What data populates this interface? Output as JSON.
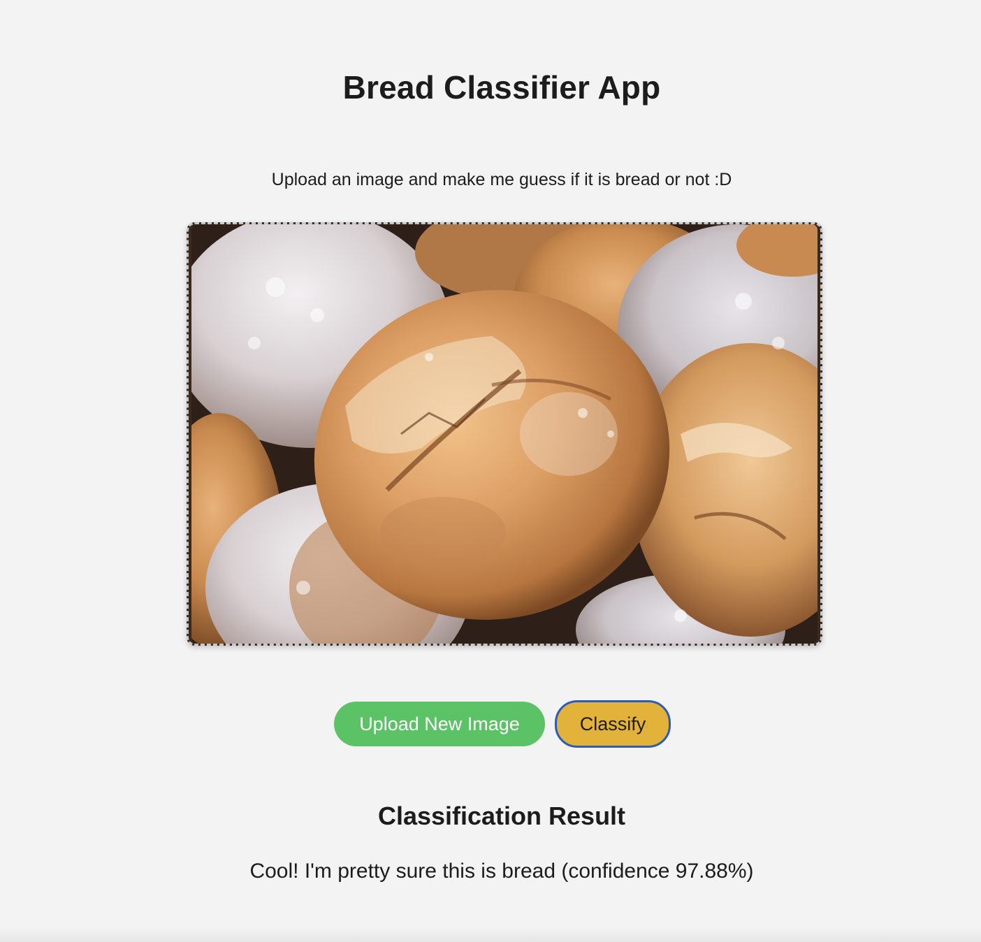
{
  "app": {
    "title": "Bread Classifier App",
    "subtitle": "Upload an image and make me guess if it is bread or not :D"
  },
  "image_preview": {
    "alt": "Photo of rustic bread loaves"
  },
  "actions": {
    "upload_label": "Upload New Image",
    "classify_label": "Classify"
  },
  "result": {
    "heading": "Classification Result",
    "message": "Cool! I'm pretty sure this is bread (confidence 97.88%)"
  },
  "colors": {
    "background": "#f3f3f3",
    "upload_button": "#5cc266",
    "classify_button": "#e3b23a",
    "focus_ring": "#2c5bb8"
  }
}
